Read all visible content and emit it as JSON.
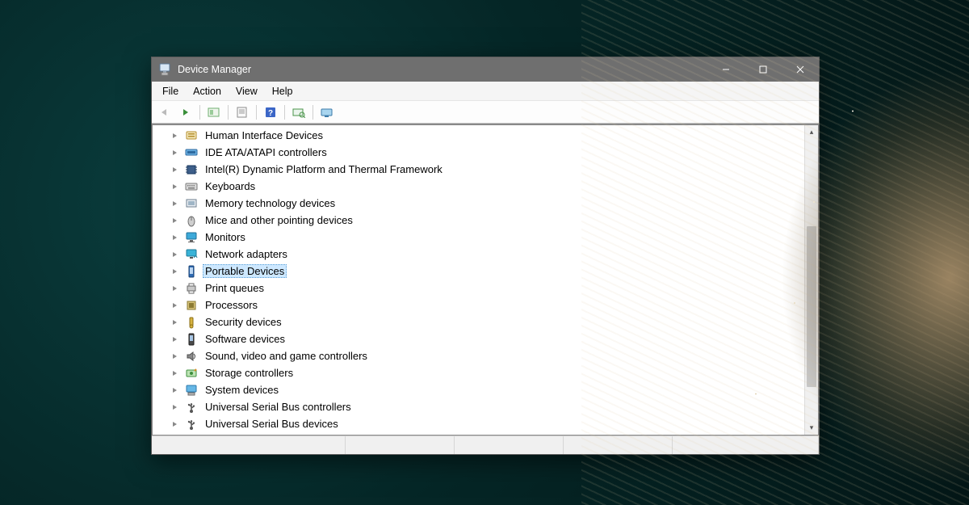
{
  "window": {
    "title": "Device Manager"
  },
  "menubar": {
    "items": [
      "File",
      "Action",
      "View",
      "Help"
    ]
  },
  "toolbar": {
    "buttons": [
      {
        "name": "nav-back",
        "disabled": true
      },
      {
        "name": "nav-forward",
        "disabled": false
      },
      {
        "sep": true
      },
      {
        "name": "show-hide-console-tree",
        "disabled": false
      },
      {
        "sep": true
      },
      {
        "name": "properties",
        "disabled": false
      },
      {
        "sep": true
      },
      {
        "name": "help",
        "disabled": false
      },
      {
        "sep": true
      },
      {
        "name": "scan-hardware",
        "disabled": false
      },
      {
        "sep": true
      },
      {
        "name": "add-legacy-hardware",
        "disabled": false
      }
    ]
  },
  "tree": {
    "selected_index": 8,
    "items": [
      {
        "label": "Human Interface Devices",
        "icon": "hid"
      },
      {
        "label": "IDE ATA/ATAPI controllers",
        "icon": "ide"
      },
      {
        "label": "Intel(R) Dynamic Platform and Thermal Framework",
        "icon": "chip"
      },
      {
        "label": "Keyboards",
        "icon": "keyboard"
      },
      {
        "label": "Memory technology devices",
        "icon": "memory"
      },
      {
        "label": "Mice and other pointing devices",
        "icon": "mouse"
      },
      {
        "label": "Monitors",
        "icon": "monitor"
      },
      {
        "label": "Network adapters",
        "icon": "network"
      },
      {
        "label": "Portable Devices",
        "icon": "portable"
      },
      {
        "label": "Print queues",
        "icon": "printer"
      },
      {
        "label": "Processors",
        "icon": "cpu"
      },
      {
        "label": "Security devices",
        "icon": "security"
      },
      {
        "label": "Software devices",
        "icon": "software"
      },
      {
        "label": "Sound, video and game controllers",
        "icon": "sound"
      },
      {
        "label": "Storage controllers",
        "icon": "storage"
      },
      {
        "label": "System devices",
        "icon": "system"
      },
      {
        "label": "Universal Serial Bus controllers",
        "icon": "usb"
      },
      {
        "label": "Universal Serial Bus devices",
        "icon": "usb"
      }
    ]
  }
}
